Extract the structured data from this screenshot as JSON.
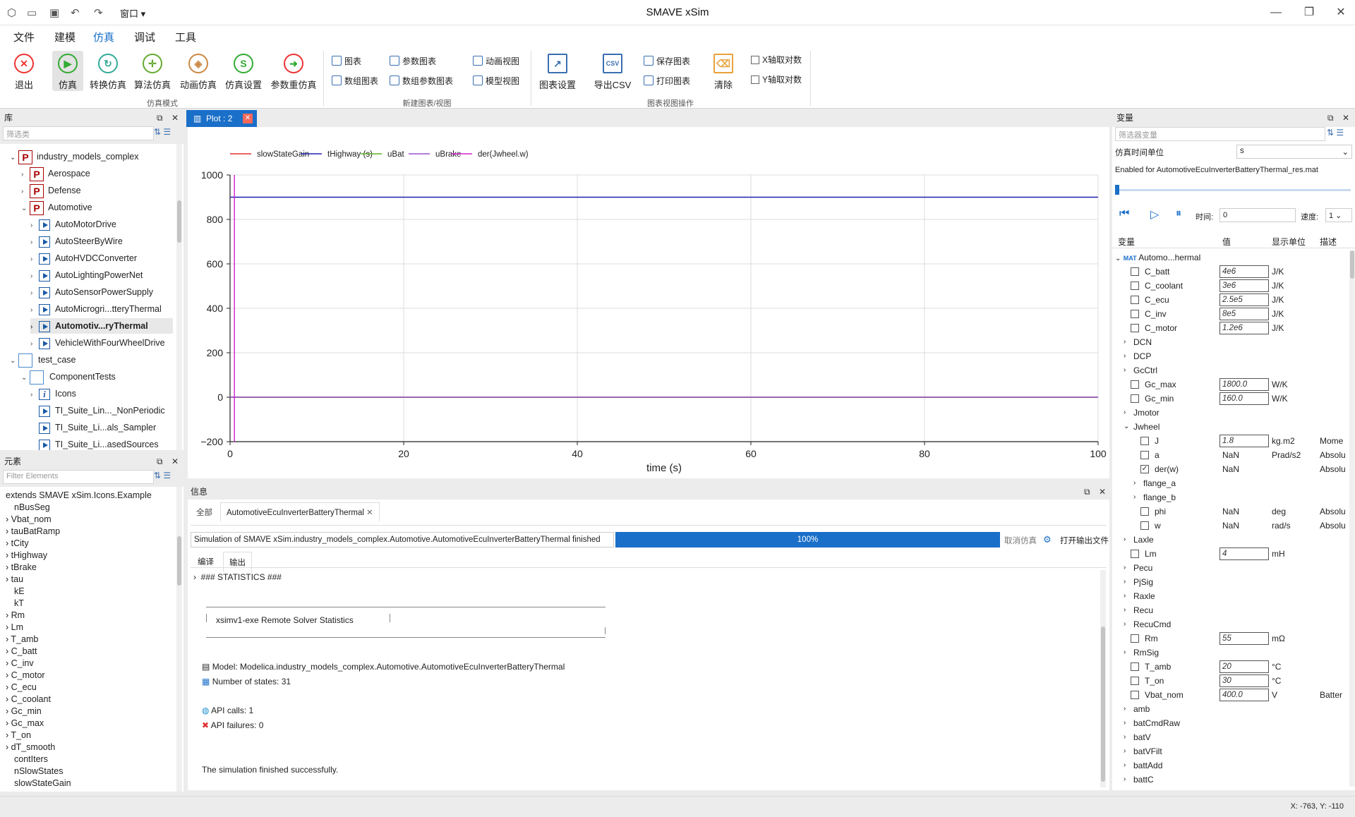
{
  "window": {
    "title": "SMAVE xSim",
    "quick_menu": "窗口"
  },
  "menu": [
    "文件",
    "建模",
    "仿真",
    "调试",
    "工具"
  ],
  "ribbon": {
    "mode_buttons": [
      "退出",
      "仿真",
      "转换仿真",
      "算法仿真",
      "动画仿真",
      "仿真设置",
      "参数重仿真"
    ],
    "mode_group": "仿真模式",
    "new_buttons": [
      "图表",
      "数组图表",
      "参数图表",
      "数组参数图表",
      "动画视图",
      "模型视图"
    ],
    "new_group": "新建图表/视图",
    "chart_settings": "图表设置",
    "export_csv": "导出CSV",
    "save_chart": "保存图表",
    "print_chart": "打印图表",
    "clear": "清除",
    "x_log": "X轴取对数",
    "y_log": "Y轴取对数",
    "chart_group": "图表视图操作"
  },
  "library": {
    "title": "库",
    "filter_placeholder": "筛选类",
    "items": [
      {
        "label": "industry_models_complex"
      },
      {
        "label": "Aerospace"
      },
      {
        "label": "Defense"
      },
      {
        "label": "Automotive"
      },
      {
        "label": "AutoMotorDrive"
      },
      {
        "label": "AutoSteerByWire"
      },
      {
        "label": "AutoHVDCConverter"
      },
      {
        "label": "AutoLightingPowerNet"
      },
      {
        "label": "AutoSensorPowerSupply"
      },
      {
        "label": "AutoMicrogri...tteryThermal"
      },
      {
        "label": "Automotiv...ryThermal"
      },
      {
        "label": "VehicleWithFourWheelDrive"
      },
      {
        "label": "test_case"
      },
      {
        "label": "ComponentTests"
      },
      {
        "label": "Icons"
      },
      {
        "label": "TI_Suite_Lin..._NonPeriodic"
      },
      {
        "label": "TI_Suite_Li...als_Sampler"
      },
      {
        "label": "TI_Suite_Li...asedSources"
      }
    ]
  },
  "elements": {
    "title": "元素",
    "filter_placeholder": "Filter Elements",
    "items": [
      "extends SMAVE xSim.Icons.Example",
      "nBusSeg",
      "Vbat_nom",
      "tauBatRamp",
      "tCity",
      "tHighway",
      "tBrake",
      "tau",
      "kE",
      "kT",
      "Rm",
      "Lm",
      "T_amb",
      "C_batt",
      "C_inv",
      "C_motor",
      "C_ecu",
      "C_coolant",
      "Gc_min",
      "Gc_max",
      "T_on",
      "dT_smooth",
      "contIters",
      "nSlowStates",
      "slowStateGain"
    ]
  },
  "plot": {
    "tab_label": "Plot : 2",
    "xlabel": "time (s)"
  },
  "chart_data": {
    "type": "line",
    "xlabel": "time (s)",
    "ylabel": "",
    "xlim": [
      0,
      100
    ],
    "ylim": [
      -200,
      1000
    ],
    "xticks": [
      0,
      20,
      40,
      60,
      80,
      100
    ],
    "yticks": [
      -200,
      0,
      200,
      400,
      600,
      800,
      1000
    ],
    "grid": true,
    "legend_position": "top-left",
    "series": [
      {
        "name": "slowStateGain",
        "color": "#e03030",
        "x": [
          0,
          100
        ],
        "y": [
          0,
          0
        ]
      },
      {
        "name": "tHighway (s)",
        "color": "#2020b0",
        "x": [
          0,
          100
        ],
        "y": [
          900,
          900
        ]
      },
      {
        "name": "uBat",
        "color": "#60b020",
        "x": [
          0,
          100
        ],
        "y": [
          0,
          0
        ]
      },
      {
        "name": "uBrake",
        "color": "#9a50d0",
        "x": [
          0,
          100
        ],
        "y": [
          0,
          0
        ]
      },
      {
        "name": "der(Jwheel.w)",
        "color": "#d020d0",
        "x": [
          0.5,
          0.5
        ],
        "y": [
          -200,
          1000
        ]
      }
    ]
  },
  "info": {
    "title": "信息",
    "tab_all": "全部",
    "tab_model": "AutomotiveEcuInverterBatteryThermal",
    "status_text": "Simulation of SMAVE xSim.industry_models_complex.Automotive.AutomotiveEcuInverterBatteryThermal finished",
    "progress": "100%",
    "progress_value": 1.0,
    "cancel": "取消仿真",
    "open_output": "打开输出文件",
    "subtab_compile": "编译",
    "subtab_output": "输出",
    "stats_header": "### STATISTICS ###",
    "solver_box": "xsimv1-exe Remote Solver Statistics",
    "model_line": "Model: Modelica.industry_models_complex.Automotive.AutomotiveEcuInverterBatteryThermal",
    "states_line": "Number of states: 31",
    "api_calls": "API calls: 1",
    "api_failures": "API failures: 0",
    "finished": "The simulation finished successfully."
  },
  "variables": {
    "title": "变量",
    "filter_placeholder": "筛选器变量",
    "time_unit_label": "仿真时间单位",
    "time_unit": "s",
    "enabled_for": "Enabled for AutomotiveEcuInverterBatteryThermal_res.mat",
    "time_label": "时间:",
    "time_value": "0",
    "speed_label": "速度:",
    "speed_value": "1",
    "col_var": "变量",
    "col_value": "值",
    "col_unit": "显示单位",
    "col_desc": "描述",
    "root": "Automo...hermal",
    "rows": [
      {
        "name": "C_batt",
        "value": "4e6",
        "unit": "J/K",
        "level": 1,
        "kind": "param"
      },
      {
        "name": "C_coolant",
        "value": "3e6",
        "unit": "J/K",
        "level": 1,
        "kind": "param"
      },
      {
        "name": "C_ecu",
        "value": "2.5e5",
        "unit": "J/K",
        "level": 1,
        "kind": "param"
      },
      {
        "name": "C_inv",
        "value": "8e5",
        "unit": "J/K",
        "level": 1,
        "kind": "param"
      },
      {
        "name": "C_motor",
        "value": "1.2e6",
        "unit": "J/K",
        "level": 1,
        "kind": "param"
      },
      {
        "name": "DCN",
        "level": 1,
        "kind": "group"
      },
      {
        "name": "DCP",
        "level": 1,
        "kind": "group"
      },
      {
        "name": "GcCtrl",
        "level": 1,
        "kind": "group"
      },
      {
        "name": "Gc_max",
        "value": "1800.0",
        "unit": "W/K",
        "level": 1,
        "kind": "param"
      },
      {
        "name": "Gc_min",
        "value": "160.0",
        "unit": "W/K",
        "level": 1,
        "kind": "param"
      },
      {
        "name": "Jmotor",
        "level": 1,
        "kind": "group"
      },
      {
        "name": "Jwheel",
        "level": 1,
        "kind": "group-open"
      },
      {
        "name": "J",
        "value": "1.8",
        "unit": "kg.m2",
        "desc": "Mome",
        "level": 2,
        "kind": "param"
      },
      {
        "name": "a",
        "value": "NaN",
        "unit": "Prad/s2",
        "desc": "Absolu",
        "level": 2,
        "kind": "var"
      },
      {
        "name": "der(w)",
        "value": "NaN",
        "unit": "",
        "desc": "Absolu",
        "level": 2,
        "kind": "var-checked"
      },
      {
        "name": "flange_a",
        "level": 2,
        "kind": "group"
      },
      {
        "name": "flange_b",
        "level": 2,
        "kind": "group"
      },
      {
        "name": "phi",
        "value": "NaN",
        "unit": "deg",
        "desc": "Absolu",
        "level": 2,
        "kind": "var"
      },
      {
        "name": "w",
        "value": "NaN",
        "unit": "rad/s",
        "desc": "Absolu",
        "level": 2,
        "kind": "var"
      },
      {
        "name": "Laxle",
        "level": 1,
        "kind": "group"
      },
      {
        "name": "Lm",
        "value": "4",
        "unit": "mH",
        "level": 1,
        "kind": "param"
      },
      {
        "name": "Pecu",
        "level": 1,
        "kind": "group"
      },
      {
        "name": "PjSig",
        "level": 1,
        "kind": "group"
      },
      {
        "name": "Raxle",
        "level": 1,
        "kind": "group"
      },
      {
        "name": "Recu",
        "level": 1,
        "kind": "group"
      },
      {
        "name": "RecuCmd",
        "level": 1,
        "kind": "group"
      },
      {
        "name": "Rm",
        "value": "55",
        "unit": "mΩ",
        "level": 1,
        "kind": "param"
      },
      {
        "name": "RmSig",
        "level": 1,
        "kind": "group"
      },
      {
        "name": "T_amb",
        "value": "20",
        "unit": "°C",
        "level": 1,
        "kind": "param"
      },
      {
        "name": "T_on",
        "value": "30",
        "unit": "°C",
        "level": 1,
        "kind": "param"
      },
      {
        "name": "Vbat_nom",
        "value": "400.0",
        "unit": "V",
        "desc": "Batter",
        "level": 1,
        "kind": "param"
      },
      {
        "name": "amb",
        "level": 1,
        "kind": "group"
      },
      {
        "name": "batCmdRaw",
        "level": 1,
        "kind": "group"
      },
      {
        "name": "batV",
        "level": 1,
        "kind": "group"
      },
      {
        "name": "batVFilt",
        "level": 1,
        "kind": "group"
      },
      {
        "name": "battAdd",
        "level": 1,
        "kind": "group"
      },
      {
        "name": "battC",
        "level": 1,
        "kind": "group"
      }
    ]
  },
  "status": {
    "coords": "X: -763, Y: -110"
  }
}
